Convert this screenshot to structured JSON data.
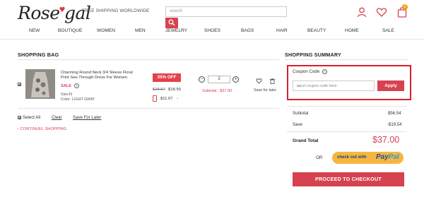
{
  "header": {
    "logo": "Rose",
    "logo_suffix": "gal",
    "free_shipping": "FREE SHIPPING WORLDWIDE",
    "search_placeholder": "search",
    "cart_count": "0"
  },
  "nav": [
    "NEW",
    "BOUTIQUE",
    "WOMEN",
    "MEN",
    "JEWELRY",
    "SHOES",
    "BAGS",
    "HAIR",
    "BEAUTY",
    "HOME",
    "SALE"
  ],
  "bag": {
    "title": "SHOPPING BAG",
    "item": {
      "name": "Charming Round Neck 3/4 Sleeve Floral Print See-Through Dress For Women",
      "sale_label": "SALE",
      "size": "Size:N",
      "color": "Color: LIGHT GRAY",
      "discount_badge": "35% OFF",
      "original_price": "$28.57",
      "sale_price": "$18.50",
      "app_price": "$11.07",
      "quantity": "2",
      "subtotal": "Subtotal : $37.00",
      "save_for_later": "Save for later"
    },
    "select_all": "Select All",
    "clear": "Clear",
    "save_for_later_link": "Save For Later",
    "continue_shopping": "CONTINUEL SHOPPING"
  },
  "summary": {
    "title": "SHOPPING SUMMARY",
    "coupon_label": "Coupon Code",
    "coupon_placeholder": "input coupon code here:",
    "apply_label": "Apply",
    "subtotal_label": "Subtotal",
    "subtotal_value": "$56.54",
    "save_label": "Save",
    "save_value": "-$19.54",
    "grand_total_label": "Grand Total",
    "grand_total_value": "$37.00",
    "or_label": "OR",
    "paypal_prefix": "check out with",
    "paypal_brand_1": "Pay",
    "paypal_brand_2": "Pal",
    "checkout_label": "PROCEED TO CHECKOUT"
  },
  "colors": {
    "accent": "#d6424f",
    "highlight_box": "#d61f2c",
    "paypal": "#f5b640"
  }
}
